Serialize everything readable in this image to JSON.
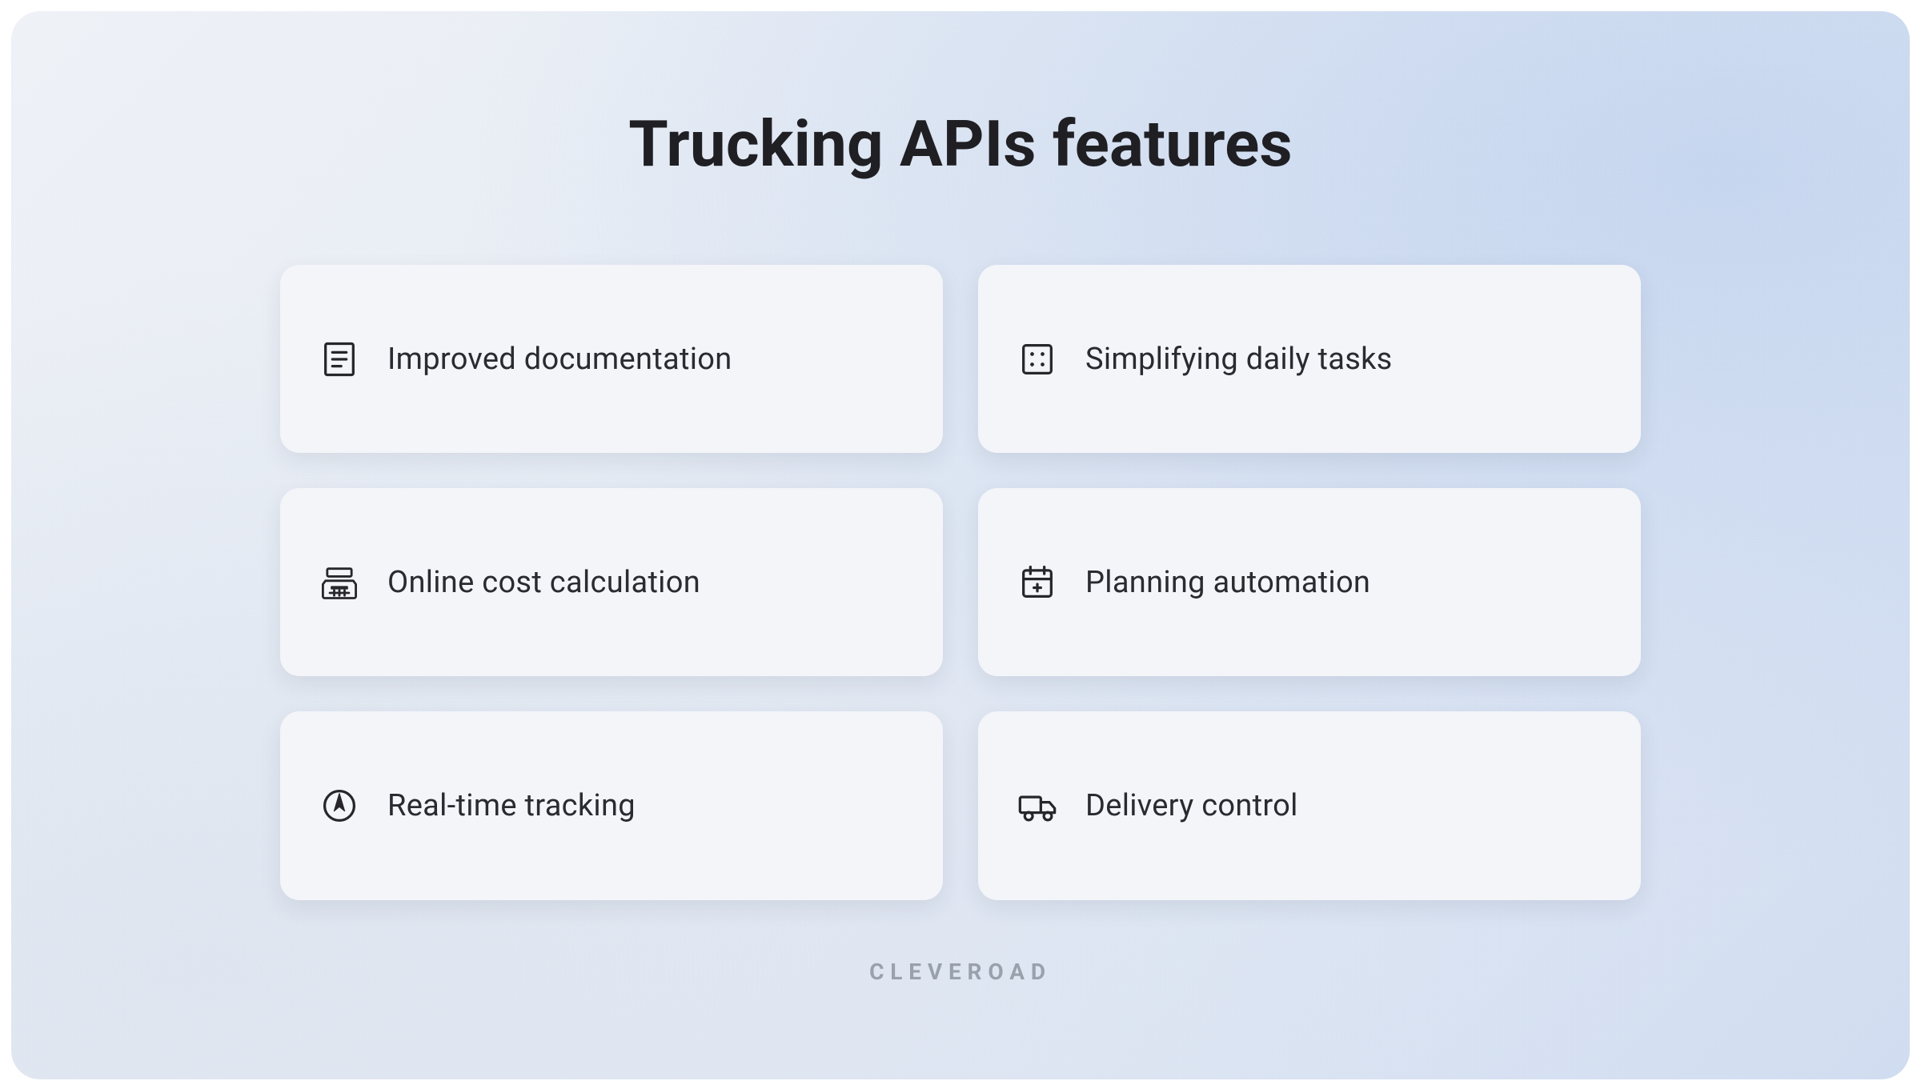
{
  "title": "Trucking APIs features",
  "features": [
    {
      "icon": "document-icon",
      "label": "Improved documentation"
    },
    {
      "icon": "grid-dots-icon",
      "label": "Simplifying daily tasks"
    },
    {
      "icon": "calculator-icon",
      "label": "Online cost calculation"
    },
    {
      "icon": "calendar-icon",
      "label": "Planning automation"
    },
    {
      "icon": "compass-icon",
      "label": "Real-time tracking"
    },
    {
      "icon": "truck-icon",
      "label": "Delivery control"
    }
  ],
  "brand": "CLEVEROAD",
  "colors": {
    "text": "#1f1f23",
    "card_bg": "#f4f5f9",
    "brand_text": "#99a1ad"
  }
}
